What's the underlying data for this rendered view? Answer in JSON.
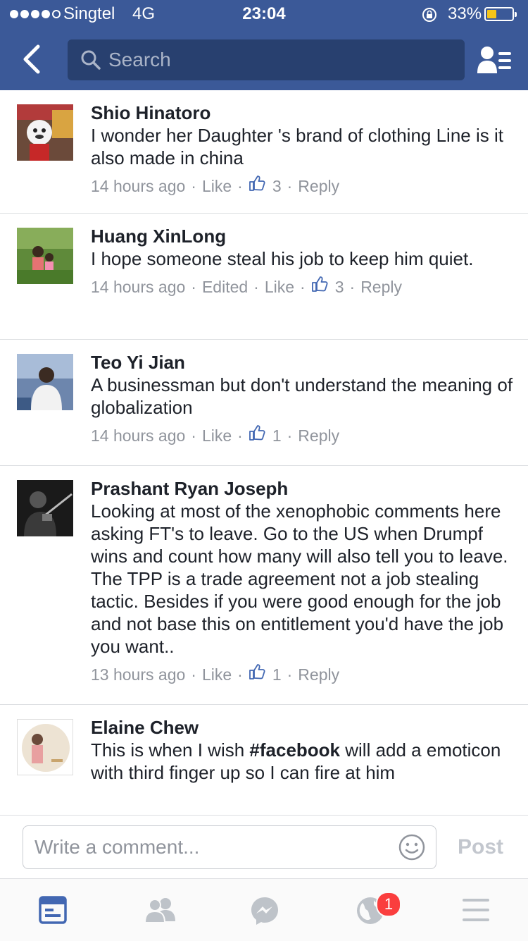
{
  "status_bar": {
    "carrier": "Singtel",
    "network": "4G",
    "time": "23:04",
    "battery_percent": "33%",
    "battery_level": 0.33
  },
  "nav": {
    "search_placeholder": "Search"
  },
  "comments": [
    {
      "author": "Shio Hinatoro",
      "text": "I wonder her Daughter 's brand of clothing Line is it also made in china",
      "time": "14 hours ago",
      "edited": "",
      "like": "Like",
      "likes": "3",
      "reply": "Reply"
    },
    {
      "author": "Huang XinLong",
      "text": "I hope someone steal his job to keep him quiet.",
      "time": "14 hours ago",
      "edited": "Edited",
      "like": "Like",
      "likes": "3",
      "reply": "Reply"
    },
    {
      "author": "Teo Yi Jian",
      "text": "A businessman but don't understand the meaning of globalization",
      "time": "14 hours ago",
      "edited": "",
      "like": "Like",
      "likes": "1",
      "reply": "Reply"
    },
    {
      "author": "Prashant Ryan Joseph",
      "text": "Looking at most of the xenophobic comments here asking FT's to leave. Go to the US when Drumpf wins and count how many will also tell you to leave. The TPP is a trade agreement not a job stealing tactic. Besides if you were good enough for the job and not base this on entitlement you'd have the job you want..",
      "time": "13 hours ago",
      "edited": "",
      "like": "Like",
      "likes": "1",
      "reply": "Reply"
    },
    {
      "author": "Elaine Chew",
      "text_before": "This is when I wish ",
      "hashtag": "#facebook",
      "text_after": " will add a emoticon with third finger up so I can fire at him"
    }
  ],
  "composer": {
    "placeholder": "Write a comment...",
    "post_label": "Post"
  },
  "tabbar": {
    "notifications_badge": "1"
  },
  "colors": {
    "brand": "#3b5998",
    "active_tab": "#4267b2",
    "badge": "#fa3e3e"
  }
}
